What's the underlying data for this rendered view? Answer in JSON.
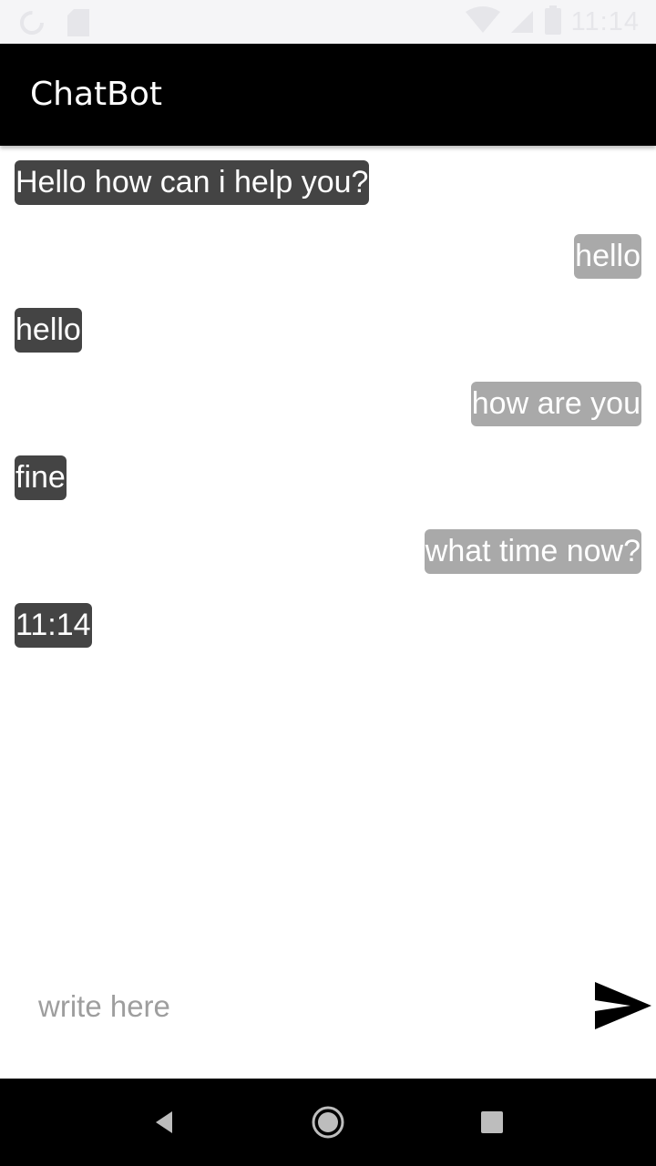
{
  "status_bar": {
    "time": "11:14",
    "icons": [
      "sync-icon",
      "sd-card-icon",
      "wifi-icon",
      "signal-icon",
      "battery-icon"
    ]
  },
  "app_bar": {
    "title": "ChatBot"
  },
  "messages": [
    {
      "sender": "bot",
      "text": "Hello how can i help you?"
    },
    {
      "sender": "user",
      "text": "hello"
    },
    {
      "sender": "bot",
      "text": "hello"
    },
    {
      "sender": "user",
      "text": "how are you"
    },
    {
      "sender": "bot",
      "text": "fine"
    },
    {
      "sender": "user",
      "text": "what time now?"
    },
    {
      "sender": "bot",
      "text": "11:14"
    }
  ],
  "composer": {
    "placeholder": "write here",
    "value": "",
    "send_icon": "send-icon"
  },
  "nav_bar": {
    "icons": [
      "back-icon",
      "home-icon",
      "recents-icon"
    ]
  },
  "colors": {
    "app_bar": "#000000",
    "bot_bubble": "#444444",
    "user_bubble": "#a9a9a9",
    "bubble_text": "#ffffff"
  }
}
